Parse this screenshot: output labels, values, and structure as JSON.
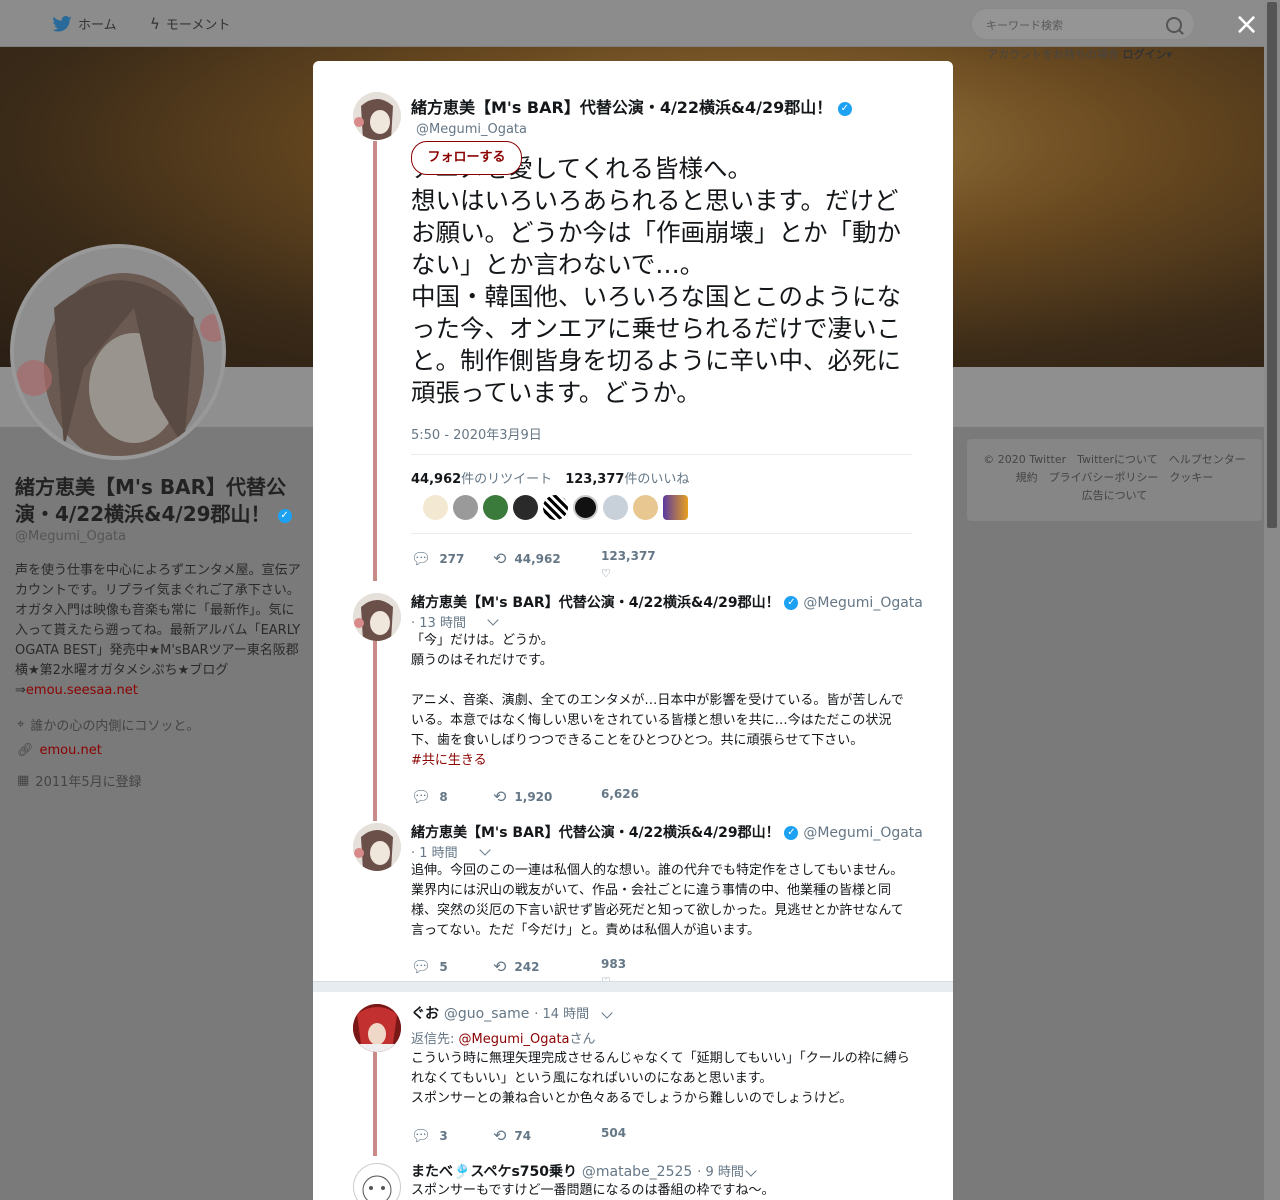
{
  "nav": {
    "home": "ホーム",
    "moments": "モーメント",
    "search_placeholder": "キーワード検索",
    "close": "×",
    "login_prompt": "アカウントをお持ちの場合",
    "login": "ログイン▾"
  },
  "profile": {
    "name": "緒方恵美【M's BAR】代替公演・4/22横浜&4/29郡山！",
    "handle": "@Megumi_Ogata",
    "bio": "声を使う仕事を中心によろずエンタメ屋。宣伝アカウントです。リプライ気まぐれご了承下さい。オガタ入門は映像も音楽も常に「最新作」。気に入って貰えたら遡ってね。最新アルバム「EARLY OGATA BEST」発売中★M'sBARツアー東名阪郡横★第2水曜オガタメシぷち★ブログ ⇒",
    "bio_link": "emou.seesaa.net",
    "location": "誰かの心の内側にコソッと。",
    "url": "emou.net",
    "joined": "2011年5月に登録"
  },
  "footer": {
    "line1": "© 2020 Twitter　Twitterについて　ヘルプセンター",
    "line2": "規約　プライバシーポリシー　クッキー",
    "line3": "広告について"
  },
  "main_tweet": {
    "name": "緒方恵美【M's BAR】代替公演・4/22横浜&4/29郡山！",
    "handle": "@Megumi_Ogata",
    "follow": "フォローする",
    "text": "アニメを愛してくれる皆様へ。\n想いはいろいろあられると思います。だけどお願い。どうか今は「作画崩壊」とか「動かない」とか言わないで…。\n中国・韓国他、いろいろな国とこのようになった今、オンエアに乗せられるだけで凄いこと。制作側皆身を切るように辛い中、必死に頑張っています。どうか。",
    "timestamp": "5:50 - 2020年3月9日",
    "retweets": "44,962",
    "retweets_label": "件のリツイート",
    "likes": "123,377",
    "likes_label": "件のいいね",
    "replies_count": "277",
    "rt_count": "44,962",
    "like_count": "123,377"
  },
  "tweets": [
    {
      "name": "緒方恵美【M's BAR】代替公演・4/22横浜&4/29郡山！",
      "handle": "@Megumi_Ogata",
      "time": "· 13 時間",
      "text": "「今」だけは。どうか。\n願うのはそれだけです。\n\nアニメ、音楽、演劇、全てのエンタメが…日本中が影響を受けている。皆が苦しんでいる。本意ではなく悔しい思いをされている皆様と想いを共に…今はただこの状況下、歯を食いしばりつつできることをひとつひとつ。共に頑張らせて下さい。",
      "hashtag": "#共に生きる",
      "replies": "8",
      "rts": "1,920",
      "likes": "6,626"
    },
    {
      "name": "緒方恵美【M's BAR】代替公演・4/22横浜&4/29郡山！",
      "handle": "@Megumi_Ogata",
      "time": "· 1 時間",
      "text": "追伸。今回のこの一連は私個人的な想い。誰の代弁でも特定作をさしてもいません。業界内には沢山の戦友がいて、作品・会社ごとに違う事情の中、他業種の皆様と同様、突然の災厄の下言い訳せず皆必死だと知って欲しかった。見逃せとか許せなんて言ってない。ただ「今だけ」と。責めは私個人が追います。",
      "replies": "5",
      "rts": "242",
      "likes": "983"
    },
    {
      "name": "ぐお",
      "handle": "@guo_same",
      "time": "· 14 時間",
      "reply_prefix": "返信先: ",
      "reply_to": "@Megumi_Ogata",
      "reply_suffix": "さん",
      "text": "こういう時に無理矢理完成させるんじゃなくて「延期してもいい」「クールの枠に縛られなくてもいい」という風になればいいのになあと思います。\nスポンサーとの兼ね合いとか色々あるでしょうから難しいのでしょうけど。",
      "replies": "3",
      "rts": "74",
      "likes": "504"
    },
    {
      "name": "またべ🎐スペケs750乗り",
      "handle": "@matabe_2525",
      "time": "· 9 時間",
      "text": "スポンサーもですけど一番問題になるのは番組の枠ですね〜。"
    }
  ]
}
